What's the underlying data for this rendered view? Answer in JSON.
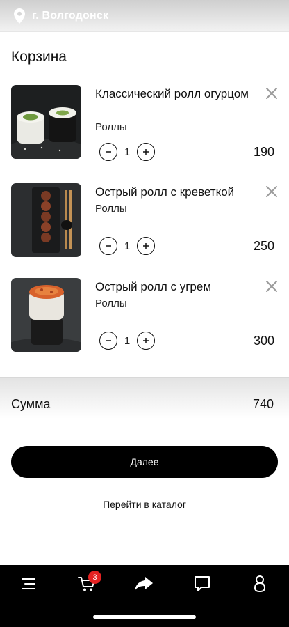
{
  "header": {
    "city": "г. Волгодонск",
    "icon": "location-pin-icon"
  },
  "cart": {
    "title": "Корзина",
    "items": [
      {
        "name": "Классический ролл огурцом",
        "category": "Роллы",
        "quantity": "1",
        "price": "190"
      },
      {
        "name": "Острый ролл с креветкой",
        "category": "Роллы",
        "quantity": "1",
        "price": "250"
      },
      {
        "name": "Острый ролл с угрем",
        "category": "Роллы",
        "quantity": "1",
        "price": "300"
      }
    ]
  },
  "summary": {
    "label": "Сумма",
    "value": "740"
  },
  "actions": {
    "next_label": "Далее",
    "catalog_label": "Перейти в каталог"
  },
  "tabbar": {
    "items": [
      {
        "icon": "menu-icon"
      },
      {
        "icon": "cart-icon",
        "badge": "3"
      },
      {
        "icon": "share-icon"
      },
      {
        "icon": "chat-icon"
      },
      {
        "icon": "user-icon"
      }
    ]
  },
  "colors": {
    "accent": "#000000",
    "badge": "#e52222",
    "background": "#ffffff"
  }
}
